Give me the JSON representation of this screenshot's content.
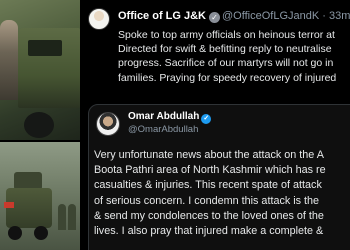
{
  "tweet_main": {
    "name": "Office of LG J&K",
    "handle": "@OfficeOfLGJandK",
    "time": "· 33m",
    "body_lines": [
      "Spoke to top army officials on heinous terror at",
      "Directed for swift & befitting reply to neutralise",
      "progress. Sacrifice of our martyrs will not go in",
      "families. Praying for speedy recovery of injured"
    ]
  },
  "tweet_quoted": {
    "name": "Omar Abdullah",
    "handle": "@OmarAbdullah",
    "body_lines": [
      "Very unfortunate news about the attack on the A",
      "Boota Pathri area of North Kashmir which has re",
      "casualties & injuries. This recent spate of attack",
      "of serious concern. I condemn this attack is the",
      "& send my condolences to the loved ones of the",
      "lives. I also pray that injured make a complete &"
    ]
  },
  "icons": {
    "verified_grey": "verified-badge-grey",
    "verified_blue": "verified-badge-blue"
  },
  "colors": {
    "background": "#000000",
    "text": "#e7e9ea",
    "muted": "#8b98a5",
    "verified_blue": "#1d9bf0"
  }
}
